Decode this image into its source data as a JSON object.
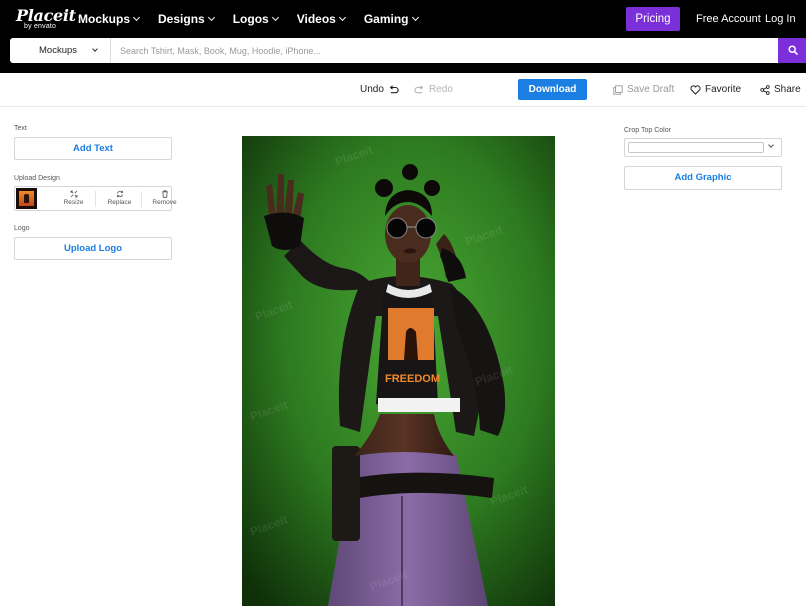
{
  "header": {
    "logo": {
      "main": "Placeit",
      "sub": "by envato"
    },
    "nav": [
      {
        "label": "Mockups"
      },
      {
        "label": "Designs"
      },
      {
        "label": "Logos"
      },
      {
        "label": "Videos"
      },
      {
        "label": "Gaming"
      }
    ],
    "pricing_label": "Pricing",
    "free_account_label": "Free Account",
    "login_label": "Log In"
  },
  "search": {
    "category": "Mockups",
    "placeholder": "Search Tshirt, Mask, Book, Mug, Hoodie, iPhone...",
    "value": ""
  },
  "toolbar": {
    "undo": "Undo",
    "redo": "Redo",
    "download": "Download",
    "save_draft": "Save Draft",
    "favorite": "Favorite",
    "share": "Share"
  },
  "left_panel": {
    "text_label": "Text",
    "add_text": "Add Text",
    "upload_design_label": "Upload Design",
    "tools": [
      "Resize",
      "Replace",
      "Remove"
    ],
    "logo_label": "Logo",
    "upload_logo": "Upload Logo"
  },
  "right_panel": {
    "crop_top_color_label": "Crop Top Color",
    "add_graphic": "Add Graphic"
  },
  "mockup": {
    "shirt_lines": [
      "FREEDOM"
    ],
    "watermark": "Placeit"
  },
  "colors": {
    "brand_purple": "#7b2fd8",
    "download_blue": "#1a7ee3",
    "background_green": "#3f9a2c"
  }
}
